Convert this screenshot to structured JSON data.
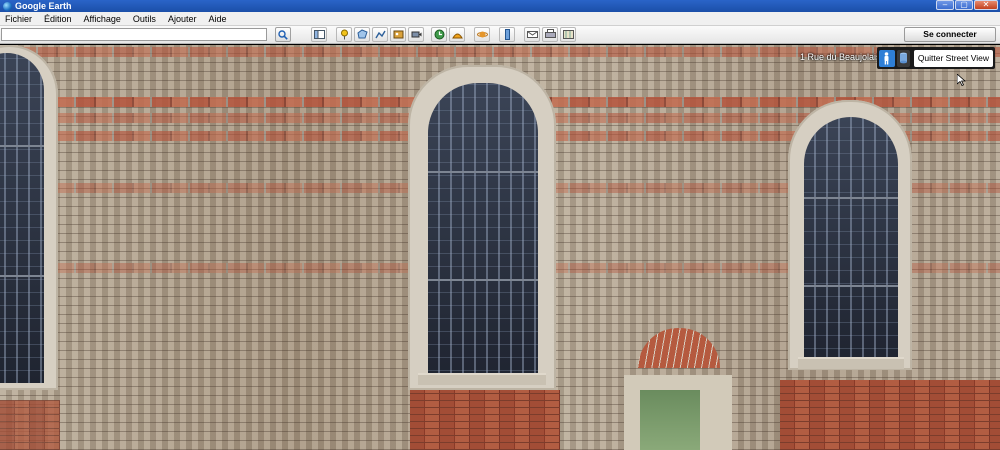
{
  "window": {
    "title": "Google Earth"
  },
  "menu": {
    "items": [
      "Fichier",
      "Édition",
      "Affichage",
      "Outils",
      "Ajouter",
      "Aide"
    ]
  },
  "toolbar": {
    "search_value": "",
    "signin_label": "Se connecter",
    "buttons": [
      "sidebar-toggle",
      "placemark",
      "polygon",
      "path",
      "image-overlay",
      "tour",
      "historical-imagery",
      "sunlight",
      "planet",
      "ruler",
      "email",
      "print",
      "view-in-maps"
    ]
  },
  "streetview": {
    "address": "1 Rue du Beaujolais",
    "exit_label": "Quitter Street View"
  },
  "colors": {
    "titlebar": "#2a64c8",
    "streetview_accent": "#2f7fd6"
  }
}
